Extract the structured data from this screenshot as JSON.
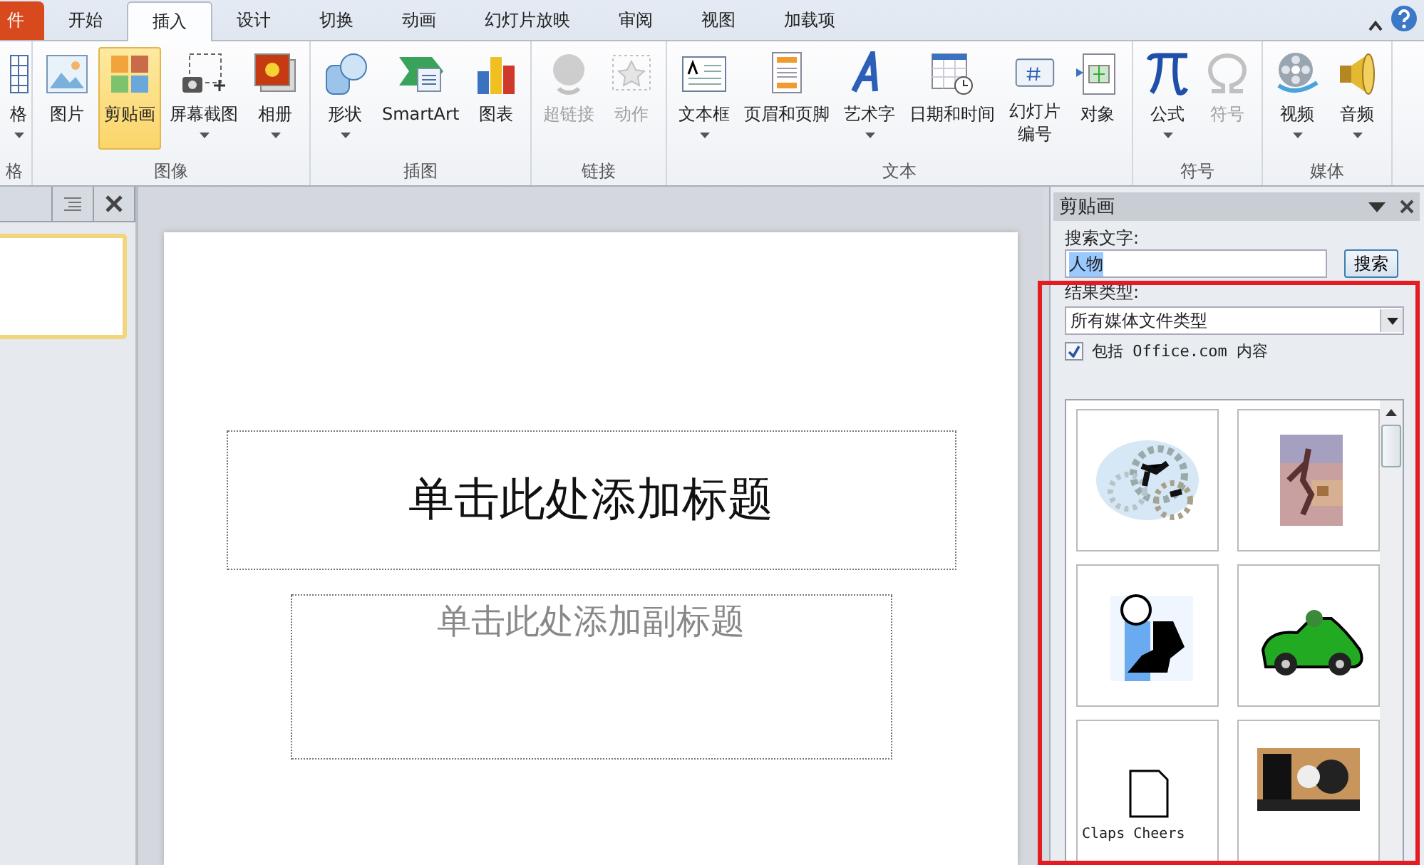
{
  "tabs": [
    {
      "label": "件",
      "kind": "file",
      "selected": false
    },
    {
      "label": "开始",
      "kind": "tab",
      "selected": false
    },
    {
      "label": "插入",
      "kind": "tab",
      "selected": true
    },
    {
      "label": "设计",
      "kind": "tab",
      "selected": false
    },
    {
      "label": "切换",
      "kind": "tab",
      "selected": false
    },
    {
      "label": "动画",
      "kind": "tab",
      "selected": false
    },
    {
      "label": "幻灯片放映",
      "kind": "tab",
      "selected": false
    },
    {
      "label": "审阅",
      "kind": "tab",
      "selected": false
    },
    {
      "label": "视图",
      "kind": "tab",
      "selected": false
    },
    {
      "label": "加载项",
      "kind": "tab",
      "selected": false
    }
  ],
  "ribbon": [
    {
      "label": "格",
      "items": [
        {
          "label": "格",
          "dropdown": true,
          "disabled": false,
          "selected": false
        }
      ]
    },
    {
      "label": "图像",
      "items": [
        {
          "label": "图片",
          "dropdown": false,
          "disabled": false,
          "selected": false
        },
        {
          "label": "剪贴画",
          "dropdown": false,
          "disabled": false,
          "selected": true
        },
        {
          "label": "屏幕截图",
          "dropdown": true,
          "disabled": false,
          "selected": false
        },
        {
          "label": "相册",
          "dropdown": true,
          "disabled": false,
          "selected": false
        }
      ]
    },
    {
      "label": "插图",
      "items": [
        {
          "label": "形状",
          "dropdown": true,
          "disabled": false,
          "selected": false
        },
        {
          "label": "SmartArt",
          "dropdown": false,
          "disabled": false,
          "selected": false
        },
        {
          "label": "图表",
          "dropdown": false,
          "disabled": false,
          "selected": false
        }
      ]
    },
    {
      "label": "链接",
      "items": [
        {
          "label": "超链接",
          "dropdown": false,
          "disabled": true,
          "selected": false
        },
        {
          "label": "动作",
          "dropdown": false,
          "disabled": true,
          "selected": false
        }
      ]
    },
    {
      "label": "文本",
      "items": [
        {
          "label": "文本框",
          "dropdown": true,
          "disabled": false,
          "selected": false
        },
        {
          "label": "页眉和页脚",
          "dropdown": false,
          "disabled": false,
          "selected": false
        },
        {
          "label": "艺术字",
          "dropdown": true,
          "disabled": false,
          "selected": false
        },
        {
          "label": "日期和时间",
          "dropdown": false,
          "disabled": false,
          "selected": false
        },
        {
          "label": [
            "幻灯片",
            "编号"
          ],
          "dropdown": false,
          "disabled": false,
          "selected": false
        },
        {
          "label": "对象",
          "dropdown": false,
          "disabled": false,
          "selected": false
        }
      ]
    },
    {
      "label": "符号",
      "items": [
        {
          "label": "公式",
          "dropdown": true,
          "disabled": false,
          "selected": false
        },
        {
          "label": "符号",
          "dropdown": false,
          "disabled": true,
          "selected": false
        }
      ]
    },
    {
      "label": "媒体",
      "items": [
        {
          "label": "视频",
          "dropdown": true,
          "disabled": false,
          "selected": false
        },
        {
          "label": "音频",
          "dropdown": true,
          "disabled": false,
          "selected": false
        }
      ]
    }
  ],
  "slide": {
    "title_placeholder": "单击此处添加标题",
    "subtitle_placeholder": "单击此处添加副标题"
  },
  "clip_pane": {
    "title": "剪贴画",
    "search_label": "搜索文字:",
    "search_value": "人物",
    "search_button": "搜索",
    "type_label": "结果类型:",
    "type_value": "所有媒体文件类型",
    "include_label": "包括 Office.com 内容",
    "include_checked": true,
    "results": [
      {
        "kind": "picture"
      },
      {
        "kind": "picture"
      },
      {
        "kind": "picture"
      },
      {
        "kind": "picture"
      },
      {
        "kind": "picture",
        "caption": "Claps Cheers"
      },
      {
        "kind": "picture"
      }
    ]
  },
  "annotation": {
    "kind": "red-frame"
  }
}
